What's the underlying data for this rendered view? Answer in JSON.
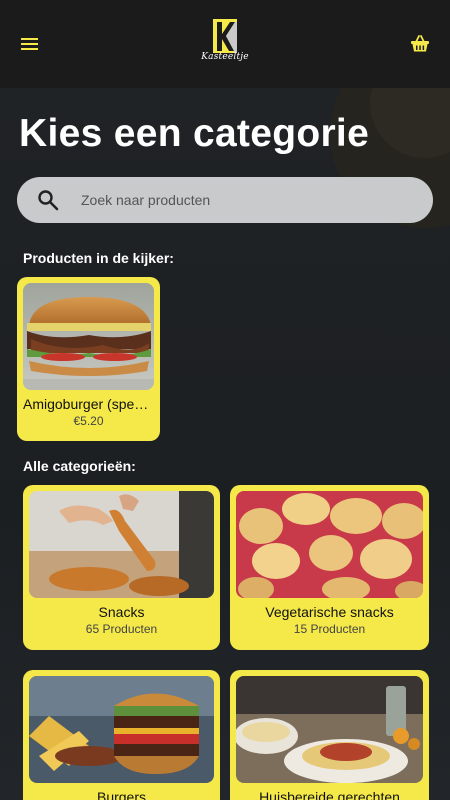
{
  "header": {
    "logo_text": "Kasteeltje",
    "menu_icon": "hamburger-menu-icon",
    "cart_icon": "shopping-basket-icon"
  },
  "page": {
    "title": "Kies een categorie"
  },
  "search": {
    "placeholder": "Zoek naar producten",
    "icon": "search-icon"
  },
  "featured": {
    "label": "Producten in de kijker:",
    "items": [
      {
        "name": "Amigoburger (spek…",
        "price": "€5.20"
      }
    ]
  },
  "categories": {
    "label": "Alle categorieën:",
    "items": [
      {
        "name": "Snacks",
        "count": "65 Producten"
      },
      {
        "name": "Vegetarische snacks",
        "count": "15 Producten"
      },
      {
        "name": "Burgers",
        "count": ""
      },
      {
        "name": "Huisbereide gerechten",
        "count": ""
      }
    ]
  },
  "colors": {
    "accent": "#f5e94a",
    "background": "#1e2124",
    "topbar": "#1b1b1b"
  }
}
